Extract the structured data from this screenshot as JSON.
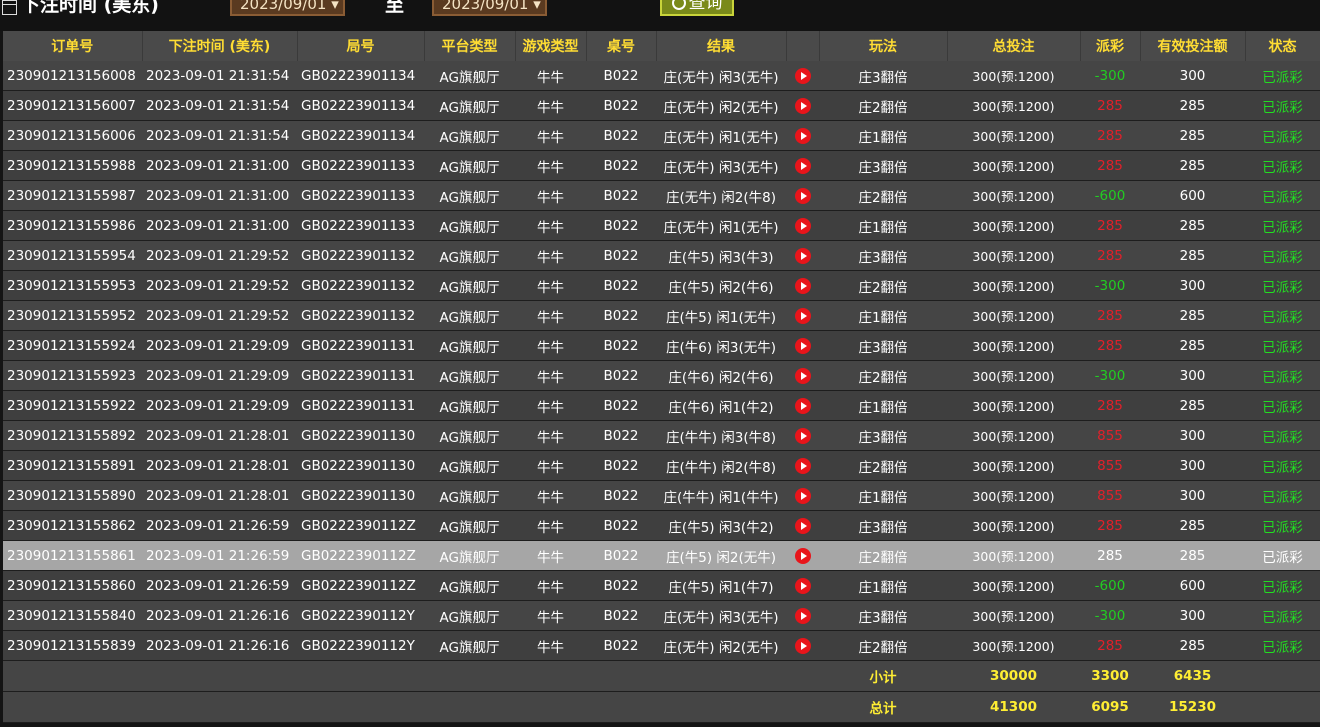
{
  "toolbar": {
    "title": "下注时间 (美东)",
    "start_date": "2023/09/01 ▾",
    "to_label": "至",
    "end_date": "2023/09/01 ▾",
    "query_label": "查询"
  },
  "table": {
    "headers": [
      "订单号",
      "下注时间 (美东)",
      "局号",
      "平台类型",
      "游戏类型",
      "桌号",
      "结果",
      "",
      "玩法",
      "总投注",
      "派彩",
      "有效投注额",
      "状态"
    ],
    "rows": [
      {
        "order": "230901213156008",
        "time": "2023-09-01 21:31:54",
        "round": "GB02223901134",
        "platform": "AG旗舰厅",
        "game": "牛牛",
        "table": "B022",
        "result": "庄(无牛) 闲3(无牛)",
        "play": "庄3翻倍",
        "bet": "300(预:1200)",
        "payout": "-300",
        "payout_type": "neg",
        "valid": "300",
        "status": "已派彩"
      },
      {
        "order": "230901213156007",
        "time": "2023-09-01 21:31:54",
        "round": "GB02223901134",
        "platform": "AG旗舰厅",
        "game": "牛牛",
        "table": "B022",
        "result": "庄(无牛) 闲2(无牛)",
        "play": "庄2翻倍",
        "bet": "300(预:1200)",
        "payout": "285",
        "payout_type": "pos",
        "valid": "285",
        "status": "已派彩"
      },
      {
        "order": "230901213156006",
        "time": "2023-09-01 21:31:54",
        "round": "GB02223901134",
        "platform": "AG旗舰厅",
        "game": "牛牛",
        "table": "B022",
        "result": "庄(无牛) 闲1(无牛)",
        "play": "庄1翻倍",
        "bet": "300(预:1200)",
        "payout": "285",
        "payout_type": "pos",
        "valid": "285",
        "status": "已派彩"
      },
      {
        "order": "230901213155988",
        "time": "2023-09-01 21:31:00",
        "round": "GB02223901133",
        "platform": "AG旗舰厅",
        "game": "牛牛",
        "table": "B022",
        "result": "庄(无牛) 闲3(无牛)",
        "play": "庄3翻倍",
        "bet": "300(预:1200)",
        "payout": "285",
        "payout_type": "pos",
        "valid": "285",
        "status": "已派彩"
      },
      {
        "order": "230901213155987",
        "time": "2023-09-01 21:31:00",
        "round": "GB02223901133",
        "platform": "AG旗舰厅",
        "game": "牛牛",
        "table": "B022",
        "result": "庄(无牛) 闲2(牛8)",
        "play": "庄2翻倍",
        "bet": "300(预:1200)",
        "payout": "-600",
        "payout_type": "neg",
        "valid": "600",
        "status": "已派彩"
      },
      {
        "order": "230901213155986",
        "time": "2023-09-01 21:31:00",
        "round": "GB02223901133",
        "platform": "AG旗舰厅",
        "game": "牛牛",
        "table": "B022",
        "result": "庄(无牛) 闲1(无牛)",
        "play": "庄1翻倍",
        "bet": "300(预:1200)",
        "payout": "285",
        "payout_type": "pos",
        "valid": "285",
        "status": "已派彩"
      },
      {
        "order": "230901213155954",
        "time": "2023-09-01 21:29:52",
        "round": "GB02223901132",
        "platform": "AG旗舰厅",
        "game": "牛牛",
        "table": "B022",
        "result": "庄(牛5) 闲3(牛3)",
        "play": "庄3翻倍",
        "bet": "300(预:1200)",
        "payout": "285",
        "payout_type": "pos",
        "valid": "285",
        "status": "已派彩"
      },
      {
        "order": "230901213155953",
        "time": "2023-09-01 21:29:52",
        "round": "GB02223901132",
        "platform": "AG旗舰厅",
        "game": "牛牛",
        "table": "B022",
        "result": "庄(牛5) 闲2(牛6)",
        "play": "庄2翻倍",
        "bet": "300(预:1200)",
        "payout": "-300",
        "payout_type": "neg",
        "valid": "300",
        "status": "已派彩"
      },
      {
        "order": "230901213155952",
        "time": "2023-09-01 21:29:52",
        "round": "GB02223901132",
        "platform": "AG旗舰厅",
        "game": "牛牛",
        "table": "B022",
        "result": "庄(牛5) 闲1(无牛)",
        "play": "庄1翻倍",
        "bet": "300(预:1200)",
        "payout": "285",
        "payout_type": "pos",
        "valid": "285",
        "status": "已派彩"
      },
      {
        "order": "230901213155924",
        "time": "2023-09-01 21:29:09",
        "round": "GB02223901131",
        "platform": "AG旗舰厅",
        "game": "牛牛",
        "table": "B022",
        "result": "庄(牛6) 闲3(无牛)",
        "play": "庄3翻倍",
        "bet": "300(预:1200)",
        "payout": "285",
        "payout_type": "pos",
        "valid": "285",
        "status": "已派彩"
      },
      {
        "order": "230901213155923",
        "time": "2023-09-01 21:29:09",
        "round": "GB02223901131",
        "platform": "AG旗舰厅",
        "game": "牛牛",
        "table": "B022",
        "result": "庄(牛6) 闲2(牛6)",
        "play": "庄2翻倍",
        "bet": "300(预:1200)",
        "payout": "-300",
        "payout_type": "neg",
        "valid": "300",
        "status": "已派彩"
      },
      {
        "order": "230901213155922",
        "time": "2023-09-01 21:29:09",
        "round": "GB02223901131",
        "platform": "AG旗舰厅",
        "game": "牛牛",
        "table": "B022",
        "result": "庄(牛6) 闲1(牛2)",
        "play": "庄1翻倍",
        "bet": "300(预:1200)",
        "payout": "285",
        "payout_type": "pos",
        "valid": "285",
        "status": "已派彩"
      },
      {
        "order": "230901213155892",
        "time": "2023-09-01 21:28:01",
        "round": "GB02223901130",
        "platform": "AG旗舰厅",
        "game": "牛牛",
        "table": "B022",
        "result": "庄(牛牛) 闲3(牛8)",
        "play": "庄3翻倍",
        "bet": "300(预:1200)",
        "payout": "855",
        "payout_type": "pos",
        "valid": "300",
        "status": "已派彩"
      },
      {
        "order": "230901213155891",
        "time": "2023-09-01 21:28:01",
        "round": "GB02223901130",
        "platform": "AG旗舰厅",
        "game": "牛牛",
        "table": "B022",
        "result": "庄(牛牛) 闲2(牛8)",
        "play": "庄2翻倍",
        "bet": "300(预:1200)",
        "payout": "855",
        "payout_type": "pos",
        "valid": "300",
        "status": "已派彩"
      },
      {
        "order": "230901213155890",
        "time": "2023-09-01 21:28:01",
        "round": "GB02223901130",
        "platform": "AG旗舰厅",
        "game": "牛牛",
        "table": "B022",
        "result": "庄(牛牛) 闲1(牛牛)",
        "play": "庄1翻倍",
        "bet": "300(预:1200)",
        "payout": "855",
        "payout_type": "pos",
        "valid": "300",
        "status": "已派彩"
      },
      {
        "order": "230901213155862",
        "time": "2023-09-01 21:26:59",
        "round": "GB0222390112Z",
        "platform": "AG旗舰厅",
        "game": "牛牛",
        "table": "B022",
        "result": "庄(牛5) 闲3(牛2)",
        "play": "庄3翻倍",
        "bet": "300(预:1200)",
        "payout": "285",
        "payout_type": "pos",
        "valid": "285",
        "status": "已派彩"
      },
      {
        "order": "230901213155861",
        "time": "2023-09-01 21:26:59",
        "round": "GB0222390112Z",
        "platform": "AG旗舰厅",
        "game": "牛牛",
        "table": "B022",
        "result": "庄(牛5) 闲2(无牛)",
        "play": "庄2翻倍",
        "bet": "300(预:1200)",
        "payout": "285",
        "payout_type": "pos",
        "valid": "285",
        "status": "已派彩",
        "highlight": true
      },
      {
        "order": "230901213155860",
        "time": "2023-09-01 21:26:59",
        "round": "GB0222390112Z",
        "platform": "AG旗舰厅",
        "game": "牛牛",
        "table": "B022",
        "result": "庄(牛5) 闲1(牛7)",
        "play": "庄1翻倍",
        "bet": "300(预:1200)",
        "payout": "-600",
        "payout_type": "neg",
        "valid": "600",
        "status": "已派彩"
      },
      {
        "order": "230901213155840",
        "time": "2023-09-01 21:26:16",
        "round": "GB0222390112Y",
        "platform": "AG旗舰厅",
        "game": "牛牛",
        "table": "B022",
        "result": "庄(无牛) 闲3(无牛)",
        "play": "庄3翻倍",
        "bet": "300(预:1200)",
        "payout": "-300",
        "payout_type": "neg",
        "valid": "300",
        "status": "已派彩"
      },
      {
        "order": "230901213155839",
        "time": "2023-09-01 21:26:16",
        "round": "GB0222390112Y",
        "platform": "AG旗舰厅",
        "game": "牛牛",
        "table": "B022",
        "result": "庄(无牛) 闲2(无牛)",
        "play": "庄2翻倍",
        "bet": "300(预:1200)",
        "payout": "285",
        "payout_type": "pos",
        "valid": "285",
        "status": "已派彩"
      }
    ],
    "subtotal": {
      "label": "小计",
      "bet": "30000",
      "payout": "3300",
      "valid": "6435"
    },
    "total": {
      "label": "总计",
      "bet": "41300",
      "payout": "6095",
      "valid": "15230"
    }
  },
  "colors": {
    "header_text": "#ffdd33",
    "negative": "#22cc22",
    "positive": "#e0202a",
    "settled": "#22dd22",
    "play_icon": "#e8151b"
  },
  "icons": {
    "calendar": "calendar-icon",
    "query": "search-icon",
    "play": "play-circle-icon"
  }
}
